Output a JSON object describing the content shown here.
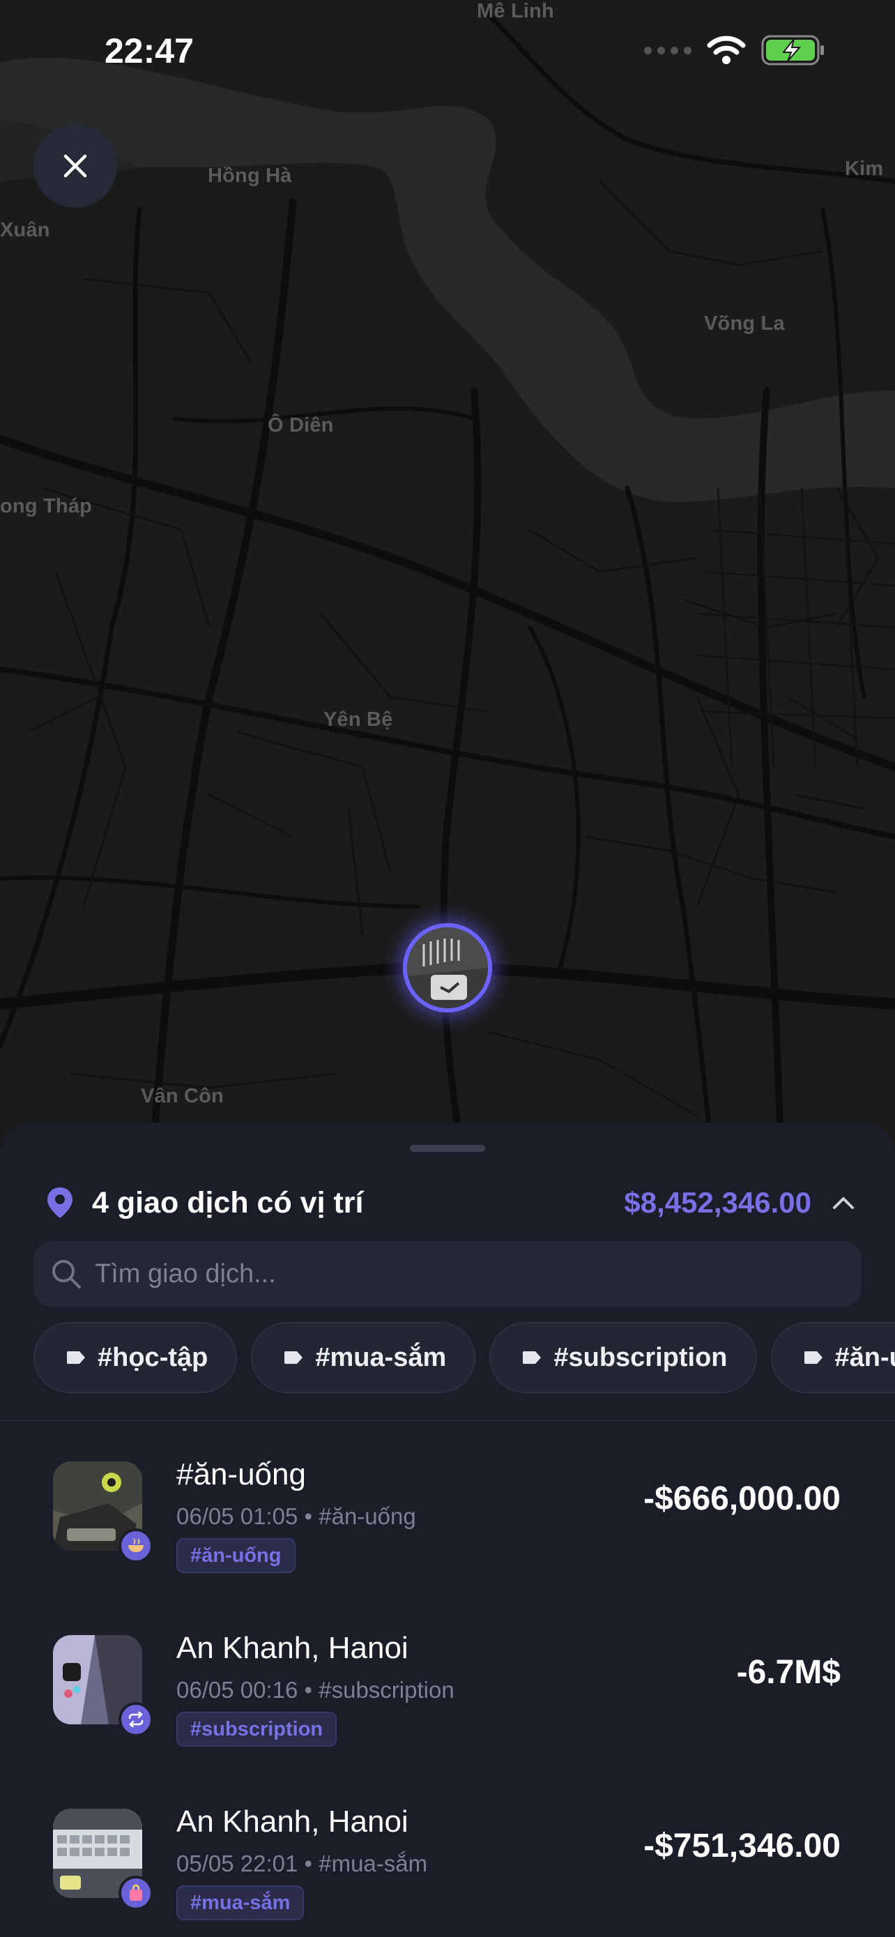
{
  "status_bar": {
    "time": "22:47"
  },
  "map": {
    "labels": [
      "Mê Linh",
      "Hồng Hà",
      "Kim",
      "Xuân",
      "Võng La",
      "Ô Diên",
      "ong Tháp",
      "Yên Bệ",
      "Vân Côn"
    ]
  },
  "summary": {
    "title": "4 giao dịch có vị trí",
    "total": "$8,452,346.00"
  },
  "search": {
    "placeholder": "Tìm giao dịch..."
  },
  "tag_chips": [
    "#học-tập",
    "#mua-sắm",
    "#subscription",
    "#ăn-uống"
  ],
  "transactions": [
    {
      "title": "#ăn-uống",
      "date": "06/05 01:05",
      "category": "#ăn-uống",
      "tag": "#ăn-uống",
      "amount": "-$666,000.00",
      "badge_icon": "food-bowl-icon"
    },
    {
      "title": "An Khanh, Hanoi",
      "date": "06/05 00:16",
      "category": "#subscription",
      "tag": "#subscription",
      "amount": "-6.7M$",
      "badge_icon": "repeat-icon"
    },
    {
      "title": "An Khanh, Hanoi",
      "date": "05/05 22:01",
      "category": "#mua-sắm",
      "tag": "#mua-sắm",
      "amount": "-$751,346.00",
      "badge_icon": "shopping-bag-icon"
    }
  ],
  "colors": {
    "accent": "#6c63ff",
    "sheet_bg": "#1b1d28",
    "map_bg": "#1b1b1b"
  }
}
